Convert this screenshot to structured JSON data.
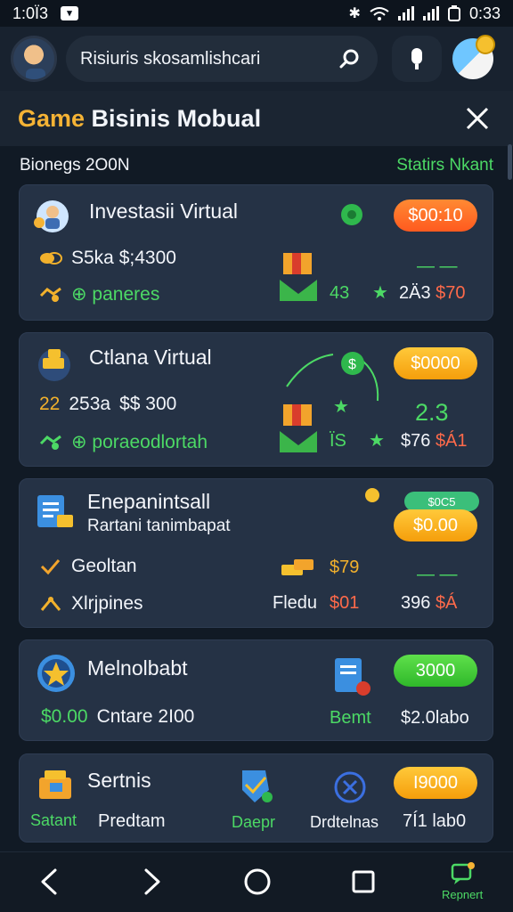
{
  "status_bar": {
    "time": "1:0Ï3",
    "right_time": "0:33"
  },
  "header": {
    "search_text": "Risiuris skosamlishcari",
    "icons": [
      "avatar",
      "search-icon",
      "mic-icon",
      "globe-icon"
    ]
  },
  "title_bar": {
    "title_accent": "Game",
    "title_rest": " Bisinis Mobual"
  },
  "section": {
    "left": "Bionegs 2O0N",
    "right": "Statirs Nkant"
  },
  "cards": [
    {
      "title": "Investasii Virtual",
      "line1": "S5ka $;4300",
      "line2": "⊕ paneres",
      "pill": "$00:10",
      "stat_top": "— —",
      "stat_left": "43",
      "stat_right_a": "2Ä3",
      "stat_right_b": "$70"
    },
    {
      "title": "Ctlana Virtual",
      "line1_a": "22",
      "line1_b": "253a",
      "line1_c": "$$ 300",
      "line2": "⊕ poraeodlortah",
      "pill": "$0000",
      "stat_top": "2.3",
      "stat_left": "ÏS",
      "stat_right_a": "$76",
      "stat_right_b": "$Á1"
    },
    {
      "title": "Enepanintsall",
      "subtitle": "Rartani tanimbapat",
      "line1": "Geoltan",
      "line2": "Xlrjpines",
      "pill_top": "$0C5",
      "pill": "$0.00",
      "stat_gold": "$79",
      "stat_field": "Fledu",
      "stat_red": "$01",
      "stat_top": "— —",
      "stat_right_a": "396",
      "stat_right_b": "$Á"
    },
    {
      "title": "Melnolbabt",
      "line1_a": "$0.00",
      "line1_b": "Cntare 2I00",
      "pill": "3000",
      "stat_mid": "Bemt",
      "stat_right": "$2.0labo"
    },
    {
      "title": "Sertnis",
      "line1_a": "Satant",
      "line1_b": "Predtam",
      "stat_mid": "Daepr",
      "stat_right_a": "Drdtelnas",
      "stat_right_b": "7Í1 lab0",
      "pill": "I9000"
    }
  ],
  "nav": {
    "label": "Repnert"
  },
  "colors": {
    "accent": "#f5b335",
    "green": "#4cd965",
    "card": "#253245",
    "background": "#111a25"
  }
}
